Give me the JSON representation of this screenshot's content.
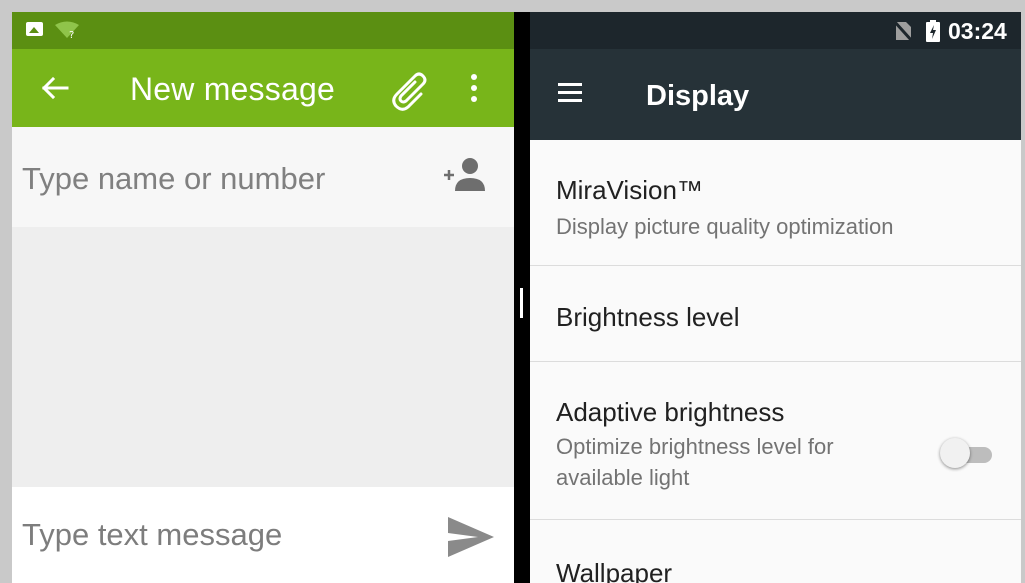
{
  "messaging": {
    "title": "New message",
    "recipient_placeholder": "Type name or number",
    "message_placeholder": "Type text message",
    "colors": {
      "status_bar": "#5b8f12",
      "app_bar": "#78b51a"
    },
    "icons": [
      "image-notification-icon",
      "wifi-unknown-icon",
      "back-arrow-icon",
      "paperclip-icon",
      "more-options-icon",
      "add-contact-icon",
      "send-icon"
    ]
  },
  "settings": {
    "status_time": "03:24",
    "title": "Display",
    "colors": {
      "status_bar": "#1d262c",
      "toolbar": "#263238"
    },
    "icons": [
      "no-sim-icon",
      "battery-charging-icon",
      "hamburger-menu-icon"
    ],
    "items": [
      {
        "title": "MiraVision™",
        "subtitle": "Display picture quality optimization"
      },
      {
        "title": "Brightness level"
      },
      {
        "title": "Adaptive brightness",
        "subtitle": "Optimize brightness level for available light",
        "toggle": "off"
      },
      {
        "title": "Wallpaper"
      }
    ]
  }
}
